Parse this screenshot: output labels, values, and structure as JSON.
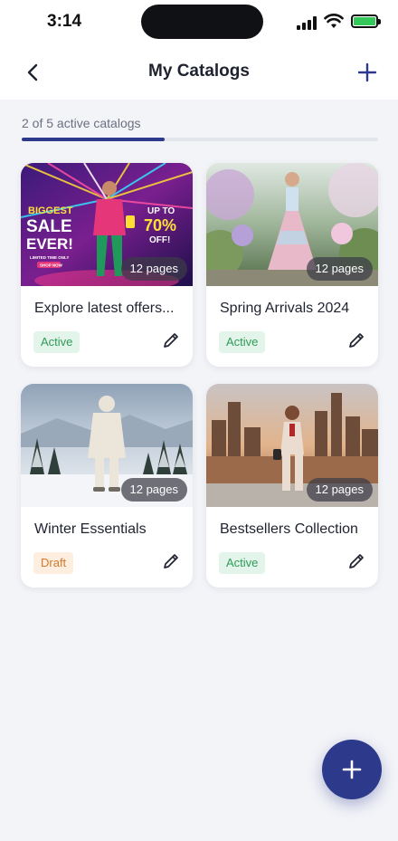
{
  "status_bar": {
    "time": "3:14"
  },
  "nav": {
    "title": "My Catalogs",
    "back_icon": "chevron-left-icon",
    "add_icon": "plus-icon"
  },
  "progress": {
    "text": "2 of 5 active catalogs",
    "fraction": 0.4
  },
  "catalogs": [
    {
      "title": "Explore latest offers...",
      "pages": "12 pages",
      "status": "Active",
      "promo": {
        "line1": "BIGGEST",
        "line2": "SALE",
        "line3": "EVER!",
        "small": "LIMITED TIME ONLY",
        "cta": "SHOP NOW",
        "right1": "UP TO",
        "right2": "70%",
        "right3": "OFF!"
      }
    },
    {
      "title": "Spring Arrivals 2024",
      "pages": "12 pages",
      "status": "Active"
    },
    {
      "title": "Winter Essentials",
      "pages": "12 pages",
      "status": "Draft"
    },
    {
      "title": "Bestsellers Collection",
      "pages": "12 pages",
      "status": "Active"
    }
  ],
  "fab": {
    "icon": "plus-icon"
  },
  "colors": {
    "accent": "#2d3a8c",
    "active_badge_bg": "#e3f5ea",
    "active_badge_text": "#2f9a58",
    "draft_badge_bg": "#fdeee0",
    "draft_badge_text": "#d2782c"
  }
}
